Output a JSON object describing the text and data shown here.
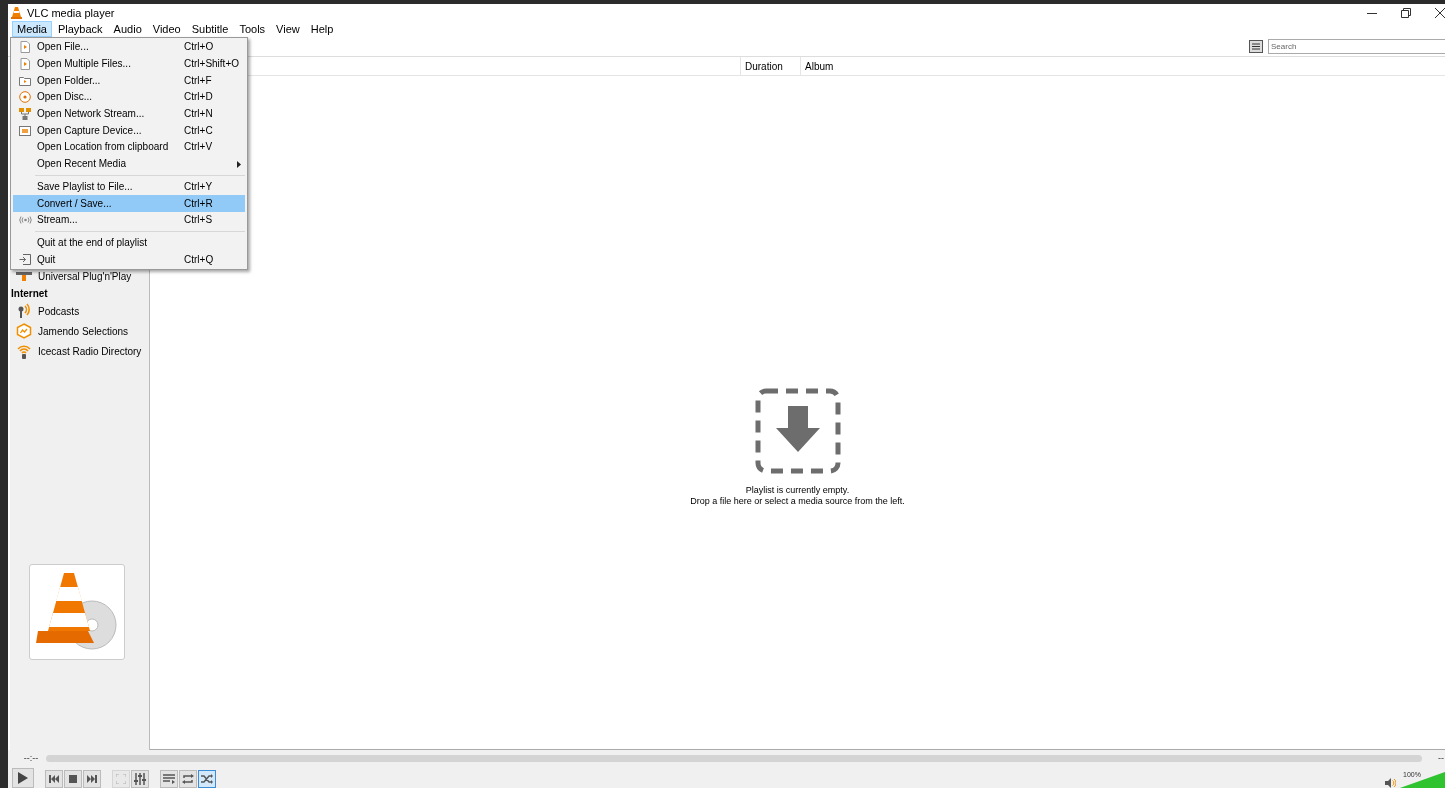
{
  "window": {
    "title": "VLC media player"
  },
  "menubar": [
    {
      "label": "Media",
      "selected": true
    },
    {
      "label": "Playback",
      "selected": false
    },
    {
      "label": "Audio",
      "selected": false
    },
    {
      "label": "Video",
      "selected": false
    },
    {
      "label": "Subtitle",
      "selected": false
    },
    {
      "label": "Tools",
      "selected": false
    },
    {
      "label": "View",
      "selected": false
    },
    {
      "label": "Help",
      "selected": false
    }
  ],
  "menu": [
    {
      "kind": "item",
      "label": "Open File...",
      "shortcut": "Ctrl+O",
      "selected": false
    },
    {
      "kind": "item",
      "label": "Open Multiple Files...",
      "shortcut": "Ctrl+Shift+O",
      "selected": false
    },
    {
      "kind": "item",
      "label": "Open Folder...",
      "shortcut": "Ctrl+F",
      "selected": false
    },
    {
      "kind": "item",
      "label": "Open Disc...",
      "shortcut": "Ctrl+D",
      "selected": false
    },
    {
      "kind": "item",
      "label": "Open Network Stream...",
      "shortcut": "Ctrl+N",
      "selected": false
    },
    {
      "kind": "item",
      "label": "Open Capture Device...",
      "shortcut": "Ctrl+C",
      "selected": false
    },
    {
      "kind": "item",
      "label": "Open Location from clipboard",
      "shortcut": "Ctrl+V",
      "selected": false
    },
    {
      "kind": "submenu",
      "label": "Open Recent Media",
      "selected": false
    },
    {
      "kind": "separator"
    },
    {
      "kind": "item",
      "label": "Save Playlist to File...",
      "shortcut": "Ctrl+Y",
      "selected": false
    },
    {
      "kind": "item",
      "label": "Convert / Save...",
      "shortcut": "Ctrl+R",
      "selected": true
    },
    {
      "kind": "item",
      "label": "Stream...",
      "shortcut": "Ctrl+S",
      "selected": false
    },
    {
      "kind": "separator"
    },
    {
      "kind": "item",
      "label": "Quit at the end of playlist",
      "selected": false
    },
    {
      "kind": "item",
      "label": "Quit",
      "shortcut": "Ctrl+Q",
      "selected": false
    }
  ],
  "search": {
    "placeholder": "Search"
  },
  "sidebar": [
    {
      "kind": "item",
      "label": "Universal Plug'n'Play"
    },
    {
      "kind": "heading",
      "label": "Internet"
    },
    {
      "kind": "item",
      "label": "Podcasts"
    },
    {
      "kind": "item",
      "label": "Jamendo Selections"
    },
    {
      "kind": "item",
      "label": "Icecast Radio Directory"
    }
  ],
  "playlist": {
    "columns": [
      "Duration",
      "Album"
    ],
    "empty_message": [
      "Playlist is currently empty.",
      "Drop a file here or select a media source from the left."
    ]
  },
  "player": {
    "elapsed": "--:--",
    "total": "--",
    "seek": {
      "level": 0
    },
    "volume": {
      "level": 1,
      "reading": "100%"
    },
    "toggles": [
      {
        "selected": false
      },
      {
        "selected": false
      },
      {
        "selected": true
      }
    ]
  }
}
